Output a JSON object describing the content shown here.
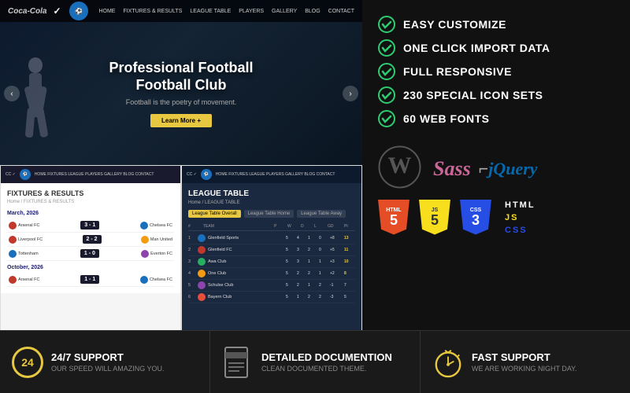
{
  "features": [
    {
      "id": "easy-customize",
      "text": "EASY CUSTOMIZE"
    },
    {
      "id": "one-click-import",
      "text": "ONE CLICK IMPORT DATA"
    },
    {
      "id": "full-responsive",
      "text": "FULL RESPONSIVE"
    },
    {
      "id": "special-icons",
      "text": "230 SPECIAL ICON SETS"
    },
    {
      "id": "web-fonts",
      "text": "60 WEB FONTS"
    }
  ],
  "hero": {
    "title1": "Professional Football",
    "title2": "Football Club",
    "subtitle": "Football is the poetry of movement.",
    "btn": "Learn More +"
  },
  "nav": {
    "logo1": "Coca-Cola",
    "logo2": "✓",
    "links": [
      "HOME",
      "FIXTURES & RESULTS",
      "LEAGUE TABLE",
      "PLAYERS",
      "GALLERY",
      "BLOG",
      "CONTACT"
    ]
  },
  "fixtures": {
    "title": "FIXTURES & RESULTS",
    "subtitle": "Home / FIXTURES & RESULTS",
    "date1": "March, 2026",
    "rows1": [
      {
        "team1": "Arsenal FC",
        "score": "3 - 1",
        "team2": "Chelsea FC"
      },
      {
        "team1": "Liverpool FC",
        "score": "2 - 2",
        "team2": "Man United"
      },
      {
        "team1": "Tottenham",
        "score": "1 - 0",
        "team2": "Everton FC"
      }
    ],
    "date2": "October, 2026",
    "rows2": [
      {
        "team1": "Arsenal FC",
        "score": "1 - 1",
        "team2": "Chelsea FC"
      }
    ]
  },
  "leagueTable": {
    "title": "LEAGUE TABLE",
    "subtitle": "Home / LEAGUE TABLE",
    "tabs": [
      "League Table Overall",
      "League Table Home",
      "League Table Away"
    ],
    "headers": [
      "TEAM",
      "P",
      "W",
      "D",
      "L",
      "GD",
      "Pt"
    ],
    "rows": [
      {
        "pos": 1,
        "name": "Glenfield Sports",
        "p": 5,
        "w": 4,
        "d": 1,
        "l": 0,
        "gd": "+8",
        "pt": 13
      },
      {
        "pos": 2,
        "name": "Glenfield FC",
        "p": 5,
        "w": 3,
        "d": 2,
        "l": 0,
        "gd": "+5",
        "pt": 11
      },
      {
        "pos": 3,
        "name": "Awa Club",
        "p": 5,
        "w": 3,
        "d": 1,
        "l": 1,
        "gd": "+3",
        "pt": 10
      },
      {
        "pos": 4,
        "name": "One Club",
        "p": 5,
        "w": 2,
        "d": 2,
        "l": 1,
        "gd": "+2",
        "pt": 8
      },
      {
        "pos": 5,
        "name": "Schulse Club",
        "p": 5,
        "w": 2,
        "d": 1,
        "l": 2,
        "gd": "-1",
        "pt": 7
      },
      {
        "pos": 6,
        "name": "Bayern Club",
        "p": 5,
        "w": 1,
        "d": 2,
        "l": 2,
        "gd": "-3",
        "pt": 5
      }
    ]
  },
  "tech": {
    "wordpress": "W",
    "sass": "Sass",
    "jquery": "jQuery",
    "html": "HTML",
    "html_num": "5",
    "js": "JS",
    "js_num": "5",
    "css": "CSS",
    "css_num": "3"
  },
  "bottom": {
    "support247": {
      "num": "24",
      "title": "24/7 SUPPORT",
      "desc": "OUR SPEED WILL AMAZING YOU."
    },
    "docs": {
      "title": "DETAILED DOCUMENTION",
      "desc": "CLEAN DOCUMENTED THEME."
    },
    "fast": {
      "title": "FAST SUPPORT",
      "desc": "WE ARE WORKING NIGHT DAY."
    }
  }
}
